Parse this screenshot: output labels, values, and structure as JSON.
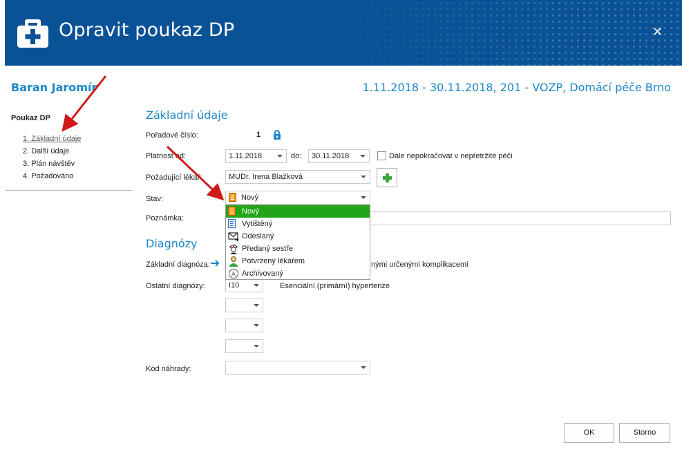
{
  "window": {
    "title": "Opravit poukaz DP",
    "close_glyph": "✕"
  },
  "patient": {
    "name": "Baran Jaromír",
    "period": "1.11.2018 - 30.11.2018, 201 - VOZP, Domácí péče Brno"
  },
  "nav": {
    "title": "Poukaz DP",
    "items": [
      {
        "label": "1. Základní údaje",
        "active": true
      },
      {
        "label": "2. Další údaje"
      },
      {
        "label": "3. Plán návštěv"
      },
      {
        "label": "4. Požadováno"
      }
    ]
  },
  "zakladni": {
    "title": "Základní údaje",
    "poradove_label": "Pořadové číslo:",
    "poradove_value": "1",
    "platnost_label": "Platnost od:",
    "platnost_od": "1.11.2018",
    "do_label": "do:",
    "platnost_do": "30.11.2018",
    "dale_label": "Dále nepokračovat v nepřetržité péči",
    "lekar_label": "Požadující lékař:",
    "lekar_value": "MUDr. Irena Blažková",
    "stav_label": "Stav:",
    "stav_value": "Nový",
    "poznamka_label": "Poznámka:"
  },
  "stav_options": [
    {
      "label": "Nový",
      "icon": "orange-document-icon",
      "selected": true
    },
    {
      "label": "Vytištěný",
      "icon": "blue-document-icon"
    },
    {
      "label": "Odeslaný",
      "icon": "envelope-icon"
    },
    {
      "label": "Předaný sestře",
      "icon": "nurse-icon"
    },
    {
      "label": "Potvrzený lékařem",
      "icon": "doctor-icon"
    },
    {
      "label": "Archivovaný",
      "icon": "archive-icon"
    }
  ],
  "diagnozy": {
    "title": "Diagnózy",
    "zakladni_label": "Základní diagnóza:",
    "zakladni_desc_visible": "nými určenými komplikacemi",
    "ostatni_label": "Ostatní diagnózy:",
    "ostatni": [
      {
        "code": "I10",
        "desc": "Esenciální (primární) hypertenze"
      },
      {
        "code": "",
        "desc": ""
      },
      {
        "code": "",
        "desc": ""
      },
      {
        "code": "",
        "desc": ""
      }
    ],
    "kod_label": "Kód náhrady:"
  },
  "buttons": {
    "ok": "OK",
    "storno": "Storno"
  },
  "colors": {
    "header": "#0a5296",
    "accent": "#1b86c8",
    "selected": "#22a51b",
    "annotation_arrow": "#d11a1a"
  }
}
